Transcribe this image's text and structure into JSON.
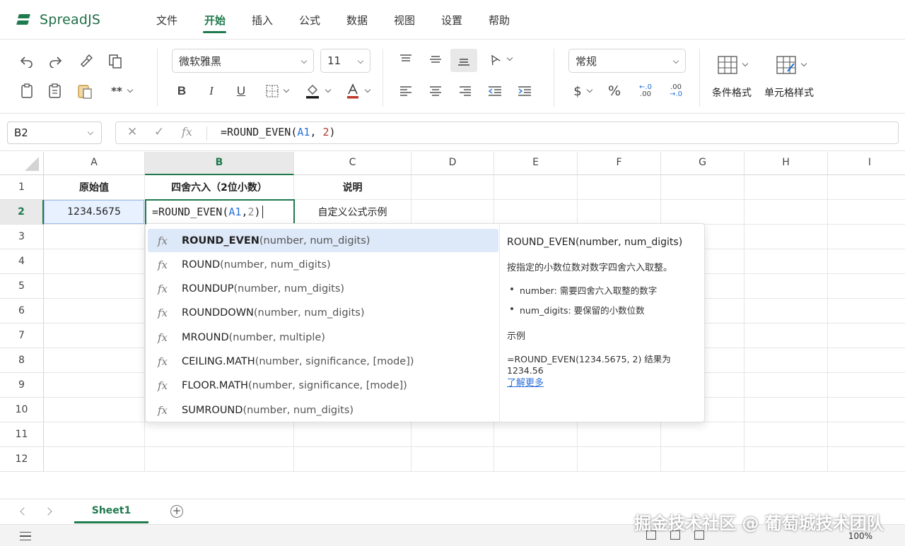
{
  "app": {
    "name": "SpreadJS"
  },
  "menu": {
    "items": [
      "文件",
      "开始",
      "插入",
      "公式",
      "数据",
      "视图",
      "设置",
      "帮助"
    ],
    "active": "开始"
  },
  "ribbon": {
    "font_name": "微软雅黑",
    "font_size": "11",
    "number_format": "常规",
    "bold": "B",
    "italic": "I",
    "underline": "U",
    "currency": "$",
    "percent": "%",
    "inc_decimal": ".00",
    "dec_decimal": ".0",
    "conditional_format": "条件格式",
    "cell_style": "单元格样式"
  },
  "formula_bar": {
    "name_box": "B2",
    "formula_parts": [
      {
        "text": "=ROUND_EVEN(",
        "color": "#222222"
      },
      {
        "text": "A1",
        "color": "#2a6fdb"
      },
      {
        "text": ", ",
        "color": "#222222"
      },
      {
        "text": "2",
        "color": "#b03a2e"
      },
      {
        "text": ")",
        "color": "#222222"
      }
    ]
  },
  "grid": {
    "columns": [
      "A",
      "B",
      "C",
      "D",
      "E",
      "F",
      "G",
      "H",
      "I"
    ],
    "rows": [
      "1",
      "2",
      "3",
      "4",
      "5",
      "6",
      "7",
      "8",
      "9",
      "10",
      "11",
      "12"
    ],
    "selected_column": "B",
    "selected_row": "2",
    "cells": {
      "A1": "原始值",
      "B1": "四舍六入（2位小数）",
      "C1": "说明",
      "A2": "1234.5675",
      "C2": "自定义公式示例"
    },
    "editor_parts": [
      {
        "text": "=ROUND_EVEN(",
        "color": "#222222"
      },
      {
        "text": "A1",
        "color": "#2a6fdb"
      },
      {
        "text": ", ",
        "color": "#222222"
      },
      {
        "text": "2",
        "color": "#888888"
      },
      {
        "text": ")",
        "color": "#222222"
      }
    ]
  },
  "autocomplete": {
    "items": [
      {
        "fn": "ROUND_EVEN",
        "args": "(number, num_digits)",
        "selected": true
      },
      {
        "fn": "ROUND",
        "args": "(number, num_digits)"
      },
      {
        "fn": "ROUNDUP",
        "args": "(number, num_digits)"
      },
      {
        "fn": "ROUNDDOWN",
        "args": "(number, num_digits)"
      },
      {
        "fn": "MROUND",
        "args": "(number, multiple)"
      },
      {
        "fn": "CEILING.MATH",
        "args": "(number, significance, [mode])"
      },
      {
        "fn": "FLOOR.MATH",
        "args": "(number, significance, [mode])"
      },
      {
        "fn": "SUMROUND",
        "args": "(number, num_digits)"
      }
    ],
    "fx_glyph": "fx",
    "detail": {
      "signature": "ROUND_EVEN(number, num_digits)",
      "description": "按指定的小数位数对数字四舍六入取整。",
      "params": [
        "number: 需要四舍六入取整的数字",
        "num_digits: 要保留的小数位数"
      ],
      "example_heading": "示例",
      "example": "=ROUND_EVEN(1234.5675, 2) 结果为 1234.56",
      "learn_more": "了解更多"
    }
  },
  "sheets": {
    "tabs": [
      "Sheet1"
    ],
    "active": "Sheet1"
  },
  "status": {
    "zoom": "100%"
  },
  "watermark": "掘金技术社区 @ 葡萄城技术团队"
}
